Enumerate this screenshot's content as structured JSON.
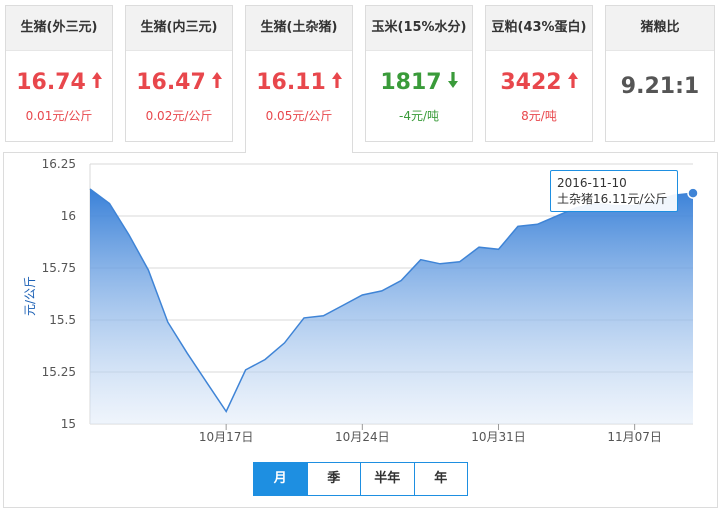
{
  "cards": [
    {
      "title": "生猪(外三元)",
      "value": "16.74",
      "change": "0.01元/公斤",
      "direction": "up",
      "color": "#e8474c"
    },
    {
      "title": "生猪(内三元)",
      "value": "16.47",
      "change": "0.02元/公斤",
      "direction": "up",
      "color": "#e8474c"
    },
    {
      "title": "生猪(土杂猪)",
      "value": "16.11",
      "change": "0.05元/公斤",
      "direction": "up",
      "color": "#e8474c"
    },
    {
      "title": "玉米(15%水分)",
      "value": "1817",
      "change": "-4元/吨",
      "direction": "down",
      "color": "#3a9b3a"
    },
    {
      "title": "豆粕(43%蛋白)",
      "value": "3422",
      "change": "8元/吨",
      "direction": "up",
      "color": "#e8474c"
    },
    {
      "title": "猪粮比",
      "value": "9.21:1",
      "change": "",
      "direction": "none",
      "color": "#555555"
    }
  ],
  "range_tabs": [
    "月",
    "季",
    "半年",
    "年"
  ],
  "tooltip": {
    "date": "2016-11-10",
    "text": "土杂猪16.11元/公斤"
  },
  "chart_data": {
    "type": "area",
    "ylabel": "元/公斤",
    "ylim": [
      15,
      16.25
    ],
    "yticks": [
      "16.25",
      "16",
      "15.75",
      "15.5",
      "15.25",
      "15"
    ],
    "xticks": [
      {
        "index": 7,
        "label": "10月17日"
      },
      {
        "index": 14,
        "label": "10月24日"
      },
      {
        "index": 21,
        "label": "10月31日"
      },
      {
        "index": 28,
        "label": "11月07日"
      }
    ],
    "x": [
      "10月10日",
      "10月11日",
      "10月12日",
      "10月13日",
      "10月14日",
      "10月15日",
      "10月16日",
      "10月17日",
      "10月18日",
      "10月19日",
      "10月20日",
      "10月21日",
      "10月22日",
      "10月23日",
      "10月24日",
      "10月25日",
      "10月26日",
      "10月27日",
      "10月28日",
      "10月29日",
      "10月30日",
      "10月31日",
      "11月01日",
      "11月02日",
      "11月03日",
      "11月04日",
      "11月05日",
      "11月06日",
      "11月07日",
      "11月08日",
      "11月09日",
      "11月10日"
    ],
    "values": [
      16.13,
      16.06,
      15.91,
      15.74,
      15.49,
      15.34,
      15.2,
      15.06,
      15.26,
      15.31,
      15.39,
      15.51,
      15.52,
      15.57,
      15.62,
      15.64,
      15.69,
      15.79,
      15.77,
      15.78,
      15.85,
      15.84,
      15.95,
      15.96,
      16.0,
      16.04,
      16.06,
      16.05,
      16.05,
      16.07,
      16.1,
      16.11
    ],
    "grid": true,
    "color": "#3f84d6"
  }
}
